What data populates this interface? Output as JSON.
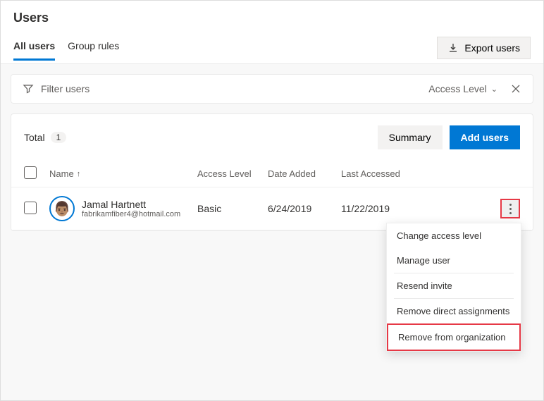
{
  "header": {
    "title": "Users",
    "tabs": {
      "all_users": "All users",
      "group_rules": "Group rules"
    },
    "export_label": "Export users"
  },
  "filter": {
    "placeholder": "Filter users",
    "access_level_label": "Access Level"
  },
  "main": {
    "total_label": "Total",
    "total_count": "1",
    "summary_label": "Summary",
    "add_users_label": "Add users"
  },
  "columns": {
    "name": "Name",
    "access_level": "Access Level",
    "date_added": "Date Added",
    "last_accessed": "Last Accessed"
  },
  "user_row": {
    "name": "Jamal Hartnett",
    "email": "fabrikamfiber4@hotmail.com",
    "access_level": "Basic",
    "date_added": "6/24/2019",
    "last_accessed": "11/22/2019",
    "avatar_emoji": "👨🏽"
  },
  "menu": {
    "change_access": "Change access level",
    "manage_user": "Manage user",
    "resend_invite": "Resend invite",
    "remove_direct": "Remove direct assignments",
    "remove_org": "Remove from organization"
  }
}
